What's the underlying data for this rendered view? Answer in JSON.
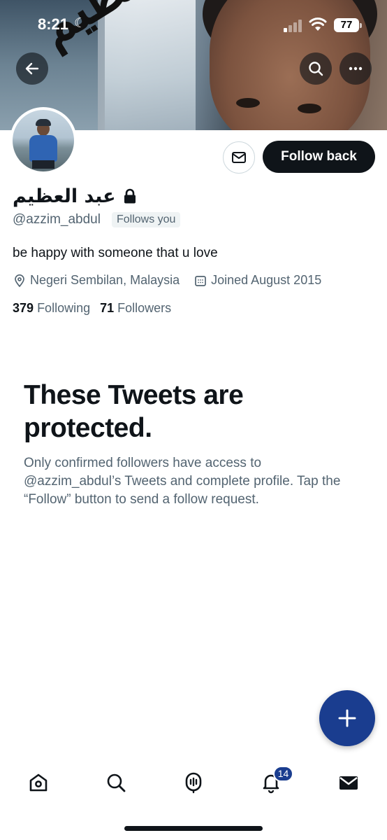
{
  "status_bar": {
    "time": "8:21",
    "battery": "77",
    "icons": [
      "moon-icon",
      "signal-icon",
      "wifi-icon",
      "battery-icon"
    ]
  },
  "banner": {
    "calligraphy": "عبد العظيم"
  },
  "header_buttons": {
    "back": "back-arrow-icon",
    "search": "search-icon",
    "more": "more-icon"
  },
  "profile": {
    "display_name": "عبد العظيم",
    "locked": true,
    "handle": "@azzim_abdul",
    "follows_you": "Follows you",
    "bio": "be happy with someone that u love",
    "location": "Negeri Sembilan, Malaysia",
    "joined": "Joined August 2015",
    "following_count": "379",
    "following_label": "Following",
    "followers_count": "71",
    "followers_label": "Followers"
  },
  "actions": {
    "message_icon": "envelope-icon",
    "follow_back_label": "Follow back"
  },
  "protected": {
    "title": "These Tweets are protected.",
    "text": "Only confirmed followers have access to @azzim_abdul’s Tweets and complete profile. Tap the “Follow” button to send a follow request."
  },
  "fab": {
    "icon": "plus-icon"
  },
  "bottom_nav": {
    "items": [
      "home-icon",
      "search-icon",
      "spaces-icon",
      "notifications-icon",
      "messages-icon"
    ],
    "notification_badge": "14"
  },
  "colors": {
    "text_primary": "#0f1419",
    "text_secondary": "#536471",
    "accent": "#1a3d8f",
    "follow_button": "#0f1419"
  }
}
